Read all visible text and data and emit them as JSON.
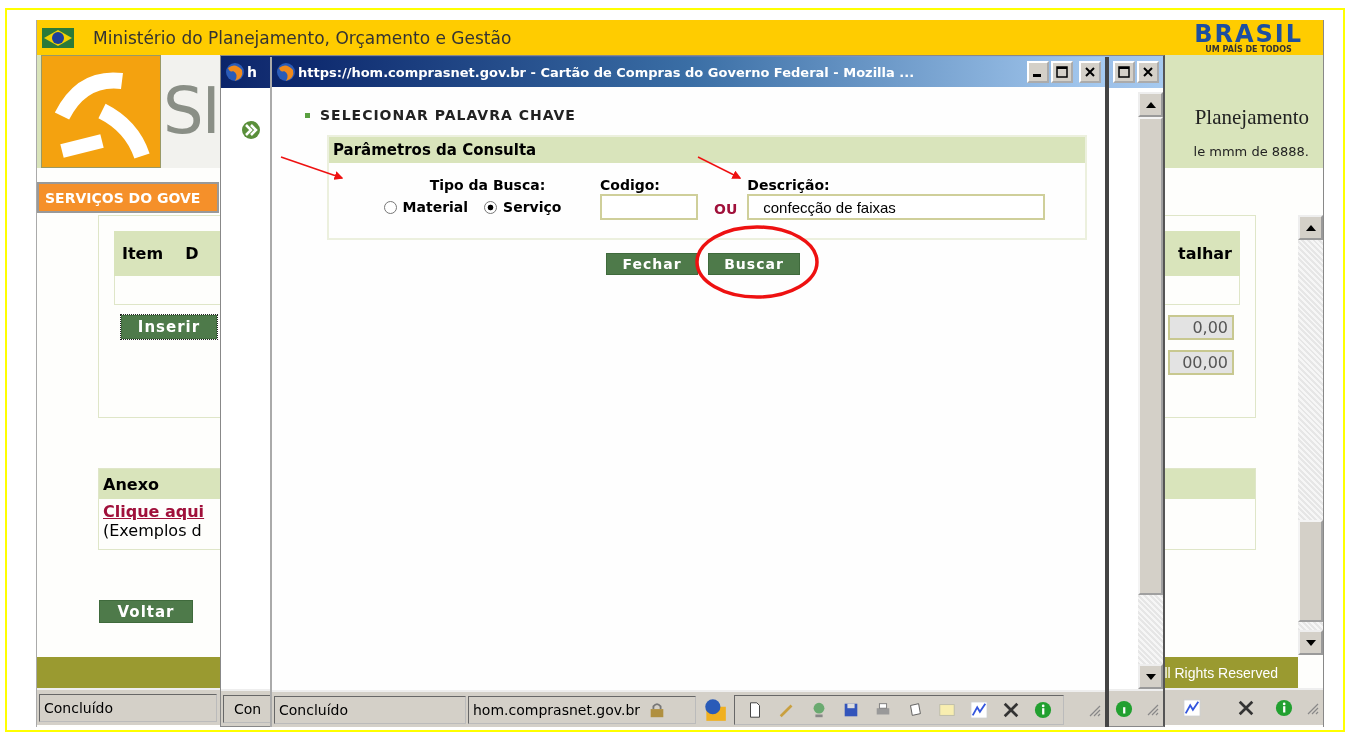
{
  "main_window": {
    "header_title": "Ministério do Planejamento, Orçamento e Gestão",
    "brand_logo": "BRASIL",
    "brand_tagline": "UM PAÍS DE TODOS",
    "logo_text": "SI",
    "site_subtitle": "Planejamento",
    "date_text": "le mmm de 8888.",
    "nav_tab": "SERVIÇOS DO GOVE",
    "table_columns": [
      "Item",
      "D",
      "talhar"
    ],
    "insert_button": "Inserir",
    "amount_fields": [
      "0,00",
      "00,00"
    ],
    "attachment": {
      "title": "Anexo",
      "link": "Clique aqui",
      "note": "(Exemplos d"
    },
    "back_button": "Voltar",
    "footer_text": "ll Rights Reserved",
    "status_text": "Concluído"
  },
  "middle_window": {
    "title": "h",
    "status_text": "Con"
  },
  "popup_window": {
    "title": "https://hom.comprasnet.gov.br - Cartão de Compras do Governo Federal - Mozilla ...",
    "section_title": "SELECIONAR PALAVRA CHAVE",
    "panel_title": "Parâmetros da Consulta",
    "search_type_label": "Tipo da Busca:",
    "search_types": [
      {
        "label": "Material",
        "selected": false
      },
      {
        "label": "Serviço",
        "selected": true
      }
    ],
    "code_label": "Codigo:",
    "or_label": "OU",
    "description_label": "Descrição:",
    "description_value": "confecção de faixas",
    "buttons": [
      "Fechar",
      "Buscar"
    ],
    "status_text": "Concluído",
    "status_url": "hom.comprasnet.gov.br"
  }
}
